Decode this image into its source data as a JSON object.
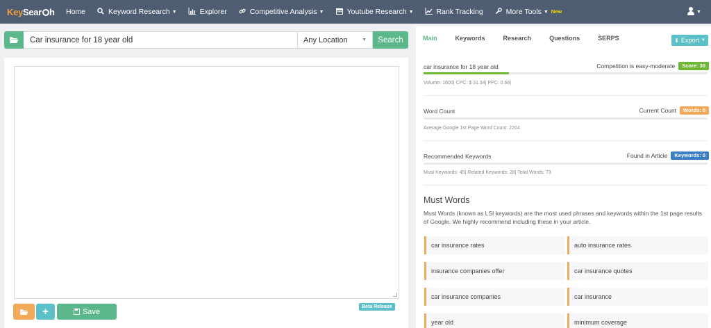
{
  "app": {
    "logo_part1": "Key",
    "logo_part2": "Sear",
    "logo_part3": "h"
  },
  "nav": {
    "items": [
      {
        "label": "Home",
        "icon": "",
        "caret": false
      },
      {
        "label": "Keyword Research",
        "icon": "search-icon",
        "caret": true
      },
      {
        "label": "Explorer",
        "icon": "bar-chart-icon",
        "caret": false
      },
      {
        "label": "Competitive Analysis",
        "icon": "link-icon",
        "caret": true
      },
      {
        "label": "Youtube Research",
        "icon": "calendar-icon",
        "caret": true
      },
      {
        "label": "Rank Tracking",
        "icon": "line-chart-icon",
        "caret": false
      },
      {
        "label": "More Tools",
        "icon": "wrench-icon",
        "caret": true,
        "badge": "New"
      }
    ]
  },
  "search": {
    "value": "Car insurance for 18 year old",
    "location": "Any Location",
    "button": "Search"
  },
  "editor": {
    "beta_label": "Beta Release",
    "save_label": "Save",
    "add_label": "+"
  },
  "right": {
    "tabs": [
      "Main",
      "Keywords",
      "Research",
      "Questions",
      "SERPS"
    ],
    "active_tab": "Main",
    "export_label": "Export",
    "keyword_row": {
      "label": "car insurance for 18 year old",
      "competition": "Competition is easy-moderate",
      "score_badge": "Score: 30",
      "score_fraction": 0.3,
      "meta": "Volume: 1600| CPC: $ 31.34| PPC: 0.68|"
    },
    "wordcount_row": {
      "label": "Word Count",
      "right_text": "Current Count",
      "badge": "Words: 0",
      "meta": "Average Google 1st Page Word Count: 2204"
    },
    "recommended_row": {
      "label": "Recommended Keywords",
      "right_text": "Found in Article",
      "badge": "Keywords: 0",
      "meta": "Must Keywords: 45| Related Keywords: 28| Total Words: 73"
    },
    "must_words": {
      "title": "Must Words",
      "description": "Must Words (known as LSI keywords) are the most used phrases and keywords within the 1st page results of Google. We highly recommend including these in your article.",
      "items": [
        "car insurance rates",
        "auto insurance rates",
        "insurance companies offer",
        "car insurance quotes",
        "car insurance companies",
        "car insurance",
        "year old",
        "minimum coverage"
      ]
    }
  },
  "colors": {
    "navbar": "#4f5d73",
    "primary_green": "#5cb88b",
    "teal": "#5bc0c8",
    "orange": "#f1a95a",
    "score_green": "#6fb735",
    "blue": "#3b7fc4"
  }
}
